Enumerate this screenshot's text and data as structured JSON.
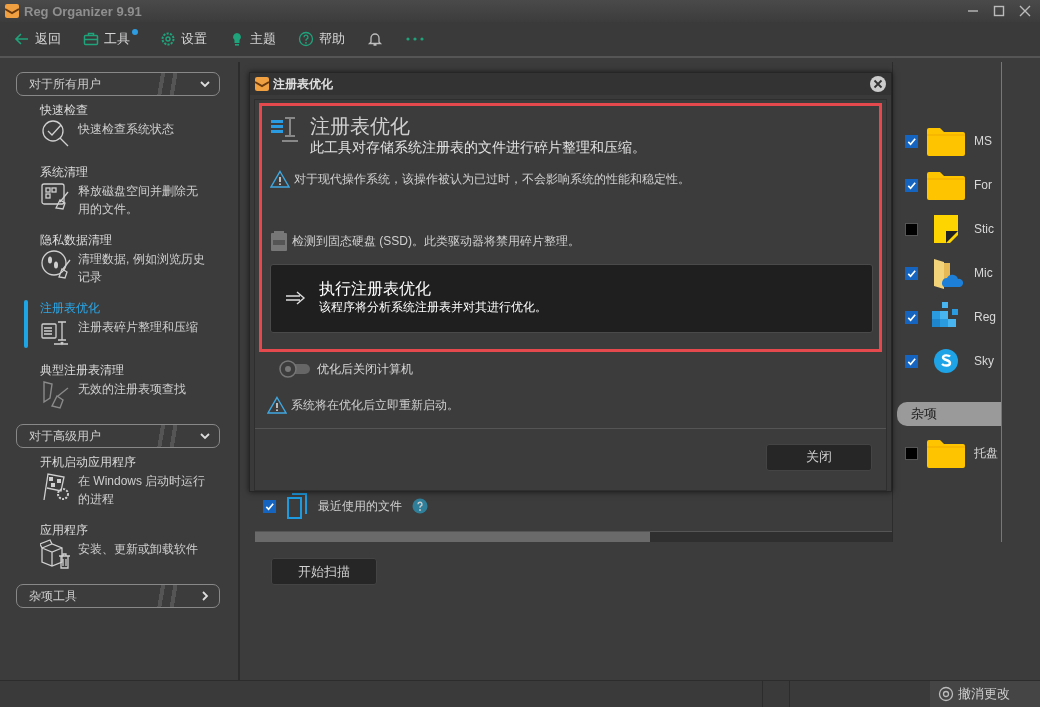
{
  "window": {
    "title": "Reg Organizer 9.91"
  },
  "toolbar": [
    {
      "kind": "back",
      "label": "返回",
      "badge": false
    },
    {
      "kind": "tools",
      "label": "工具",
      "badge": true
    },
    {
      "kind": "settings",
      "label": "设置",
      "badge": false
    },
    {
      "kind": "theme",
      "label": "主题",
      "badge": false
    },
    {
      "kind": "help",
      "label": "帮助",
      "badge": false
    },
    {
      "kind": "bell",
      "badge": false
    },
    {
      "kind": "more",
      "badge": false
    }
  ],
  "sidebar": {
    "sections": [
      {
        "title": "对于所有用户",
        "expanded": true,
        "items": [
          {
            "kind": "check",
            "title": "快速检查",
            "description": "快速检查系统状态",
            "selected": false
          },
          {
            "kind": "clean",
            "title": "系统清理",
            "description": "释放磁盘空间并删除无用的文件。",
            "selected": false
          },
          {
            "kind": "privacy",
            "title": "隐私数据清理",
            "description": "清理数据, 例如浏览历史记录",
            "selected": false
          },
          {
            "kind": "registry",
            "title": "注册表优化",
            "description": "注册表碎片整理和压缩",
            "selected": true
          },
          {
            "kind": "broom",
            "title": "典型注册表清理",
            "description": "无效的注册表项查找",
            "selected": false
          }
        ]
      },
      {
        "title": "对于高级用户",
        "expanded": true,
        "items": [
          {
            "kind": "startup",
            "title": "开机启动应用程序",
            "description": "在 Windows 启动时运行的进程",
            "selected": false
          },
          {
            "kind": "apps",
            "title": "应用程序",
            "description": "安装、更新或卸载软件",
            "selected": false
          }
        ]
      },
      {
        "title": "杂项工具",
        "expanded": false
      }
    ]
  },
  "background": {
    "apps": [
      {
        "kind": "folder",
        "label": "MS",
        "checked": true
      },
      {
        "kind": "folder",
        "label": "For",
        "checked": true
      },
      {
        "kind": "note",
        "label": "Stic",
        "checked": false
      },
      {
        "kind": "cloud",
        "label": "Mic",
        "checked": true
      },
      {
        "kind": "cubes",
        "label": "Reg",
        "checked": true
      },
      {
        "kind": "skype",
        "label": "Sky",
        "checked": true
      }
    ],
    "group": "杂项",
    "group_items": [
      {
        "kind": "folder",
        "label": "托盘",
        "checked": false
      }
    ],
    "recent": {
      "label": "最近使用的文件",
      "checked": true
    },
    "scan_button": "开始扫描"
  },
  "dialog": {
    "title": "注册表优化",
    "heading": "注册表优化",
    "subtitle": "此工具对存储系统注册表的文件进行碎片整理和压缩。",
    "warning": "对于现代操作系统，该操作被认为已过时，不会影响系统的性能和稳定性。",
    "ssd_note": "检测到固态硬盘 (SSD)。此类驱动器将禁用碎片整理。",
    "action": {
      "title": "执行注册表优化",
      "description": "该程序将分析系统注册表并对其进行优化。"
    },
    "shutdown": {
      "label": "优化后关闭计算机",
      "on": false
    },
    "restart_note": "系统将在优化后立即重新启动。",
    "close_button": "关闭"
  },
  "status_bar": {
    "undo": "撤消更改"
  }
}
